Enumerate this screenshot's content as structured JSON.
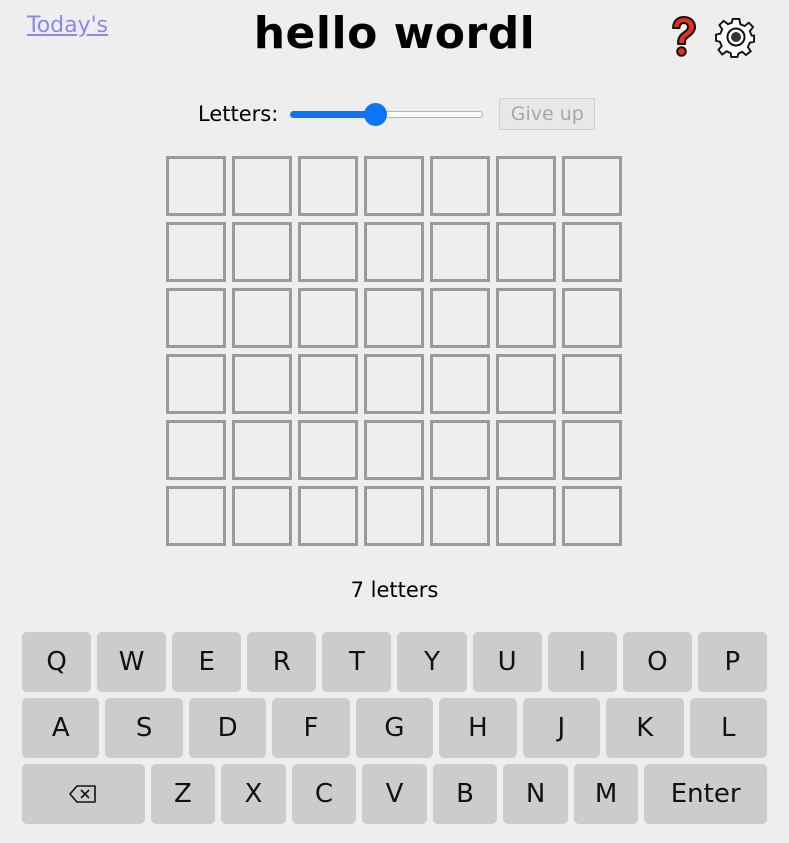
{
  "header": {
    "today_link": "Today's",
    "title": "hello wordl",
    "help_icon": "question-mark-icon",
    "settings_icon": "gear-icon"
  },
  "controls": {
    "letters_label": "Letters:",
    "slider_value": 7,
    "slider_min": 4,
    "slider_max": 11,
    "give_up_label": "Give up"
  },
  "board": {
    "rows": 6,
    "cols": 7,
    "guesses": []
  },
  "status": "7 letters",
  "keyboard": {
    "row1": [
      "Q",
      "W",
      "E",
      "R",
      "T",
      "Y",
      "U",
      "I",
      "O",
      "P"
    ],
    "row2": [
      "A",
      "S",
      "D",
      "F",
      "G",
      "H",
      "J",
      "K",
      "L"
    ],
    "row3": [
      "backspace-icon",
      "Z",
      "X",
      "C",
      "V",
      "B",
      "N",
      "M",
      "Enter"
    ]
  },
  "colors": {
    "background": "#eeeeee",
    "tile_border": "#9a9a9a",
    "key_bg": "#cccccc",
    "slider_accent": "#0b75f5",
    "link": "#8c86ee",
    "help_red": "#e0301e"
  }
}
